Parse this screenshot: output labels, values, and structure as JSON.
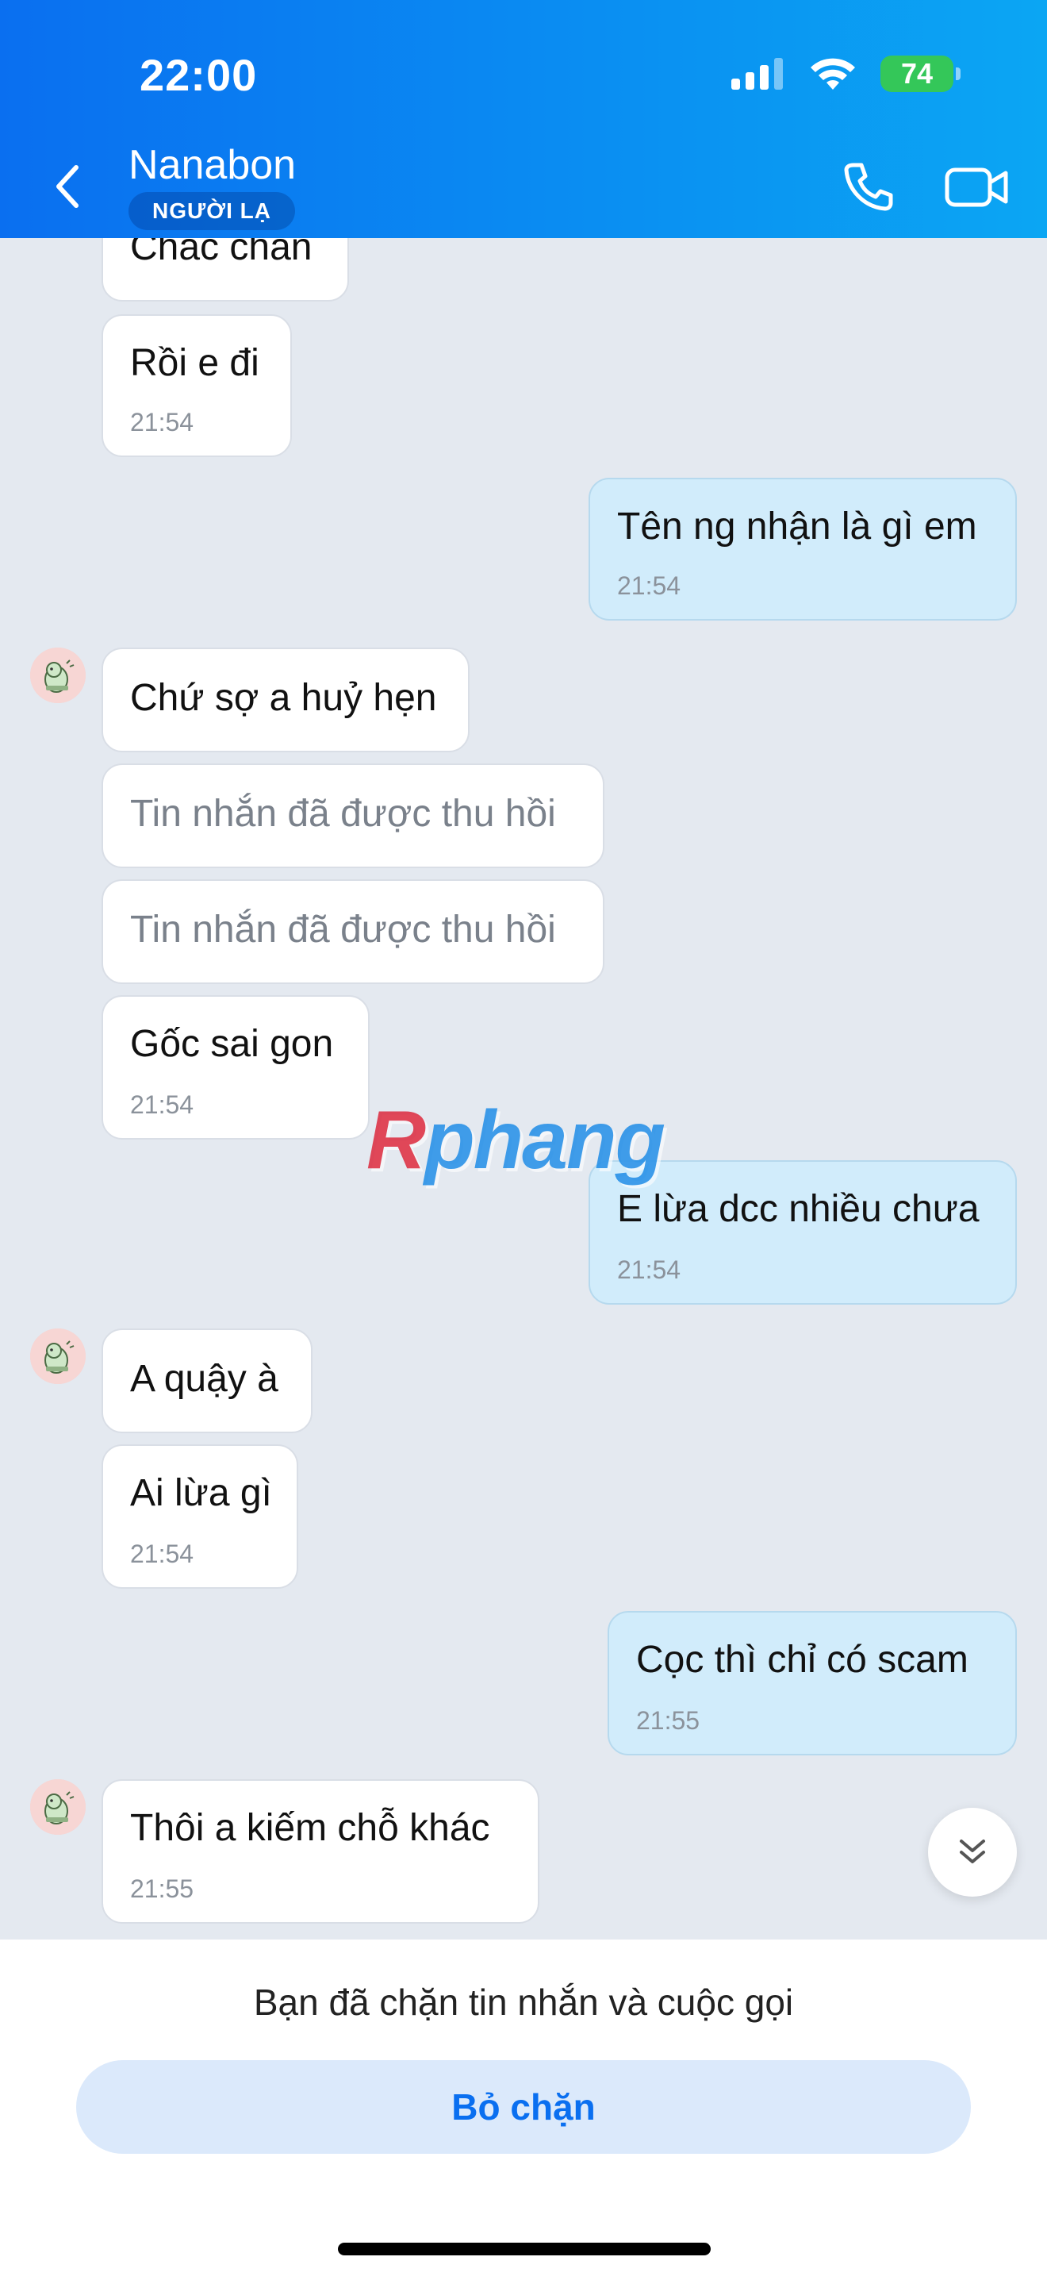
{
  "status_bar": {
    "time": "22:00",
    "battery": "74"
  },
  "header": {
    "contact_name": "Nanabon",
    "badge": "NGƯỜI LẠ"
  },
  "messages": [
    {
      "text": "Chắc chắn"
    },
    {
      "text": "Rồi e đi",
      "time": "21:54"
    },
    {
      "text": "Tên ng nhận là gì em",
      "time": "21:54"
    },
    {
      "text": "Chứ sợ a huỷ hẹn"
    },
    {
      "text": "Tin nhắn đã được thu hồi"
    },
    {
      "text": "Tin nhắn đã được thu hồi"
    },
    {
      "text": "Gốc sai gon",
      "time": "21:54"
    },
    {
      "text": "E lừa dcc nhiều chưa",
      "time": "21:54"
    },
    {
      "text": "A quậy à"
    },
    {
      "text": "Ai lừa gì",
      "time": "21:54"
    },
    {
      "text": "Cọc thì chỉ có scam",
      "time": "21:55"
    },
    {
      "text": "Thôi a kiếm chỗ khác",
      "time": "21:55"
    }
  ],
  "watermark": {
    "r": "R",
    "rest": "phang"
  },
  "footer": {
    "blocked_text": "Bạn đã chặn tin nhắn và cuộc gọi",
    "unblock_label": "Bỏ chặn"
  },
  "colors": {
    "header": "#0a7ff1",
    "outgoing_bubble": "#d1ecfb",
    "incoming_bubble": "#ffffff",
    "accent": "#0a6ff0"
  },
  "icons": [
    "back-icon",
    "phone-icon",
    "video-icon",
    "signal-icon",
    "wifi-icon",
    "battery-icon",
    "double-chevron-down-icon"
  ]
}
